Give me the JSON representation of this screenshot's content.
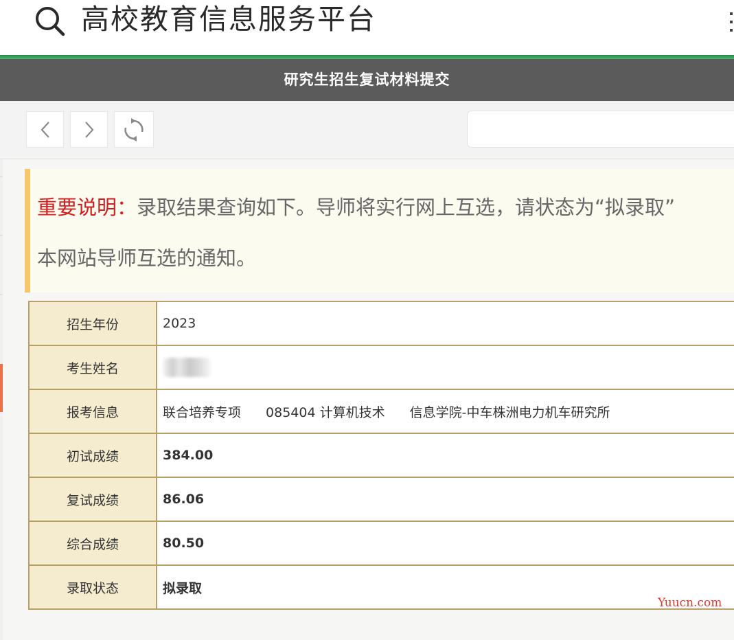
{
  "header": {
    "app_title": "高校教育信息服务平台",
    "search_icon": "search-icon",
    "accent_color": "#1d8a4a"
  },
  "title_bar": {
    "title": "研究生招生复试材料提交"
  },
  "toolbar": {
    "back_icon": "chevron-left-icon",
    "forward_icon": "chevron-right-icon",
    "refresh_icon": "refresh-icon",
    "url_value": ""
  },
  "notice": {
    "label": "重要说明：",
    "line1_text": "录取结果查询如下。导师将实行网上互选，请状态为“拟录取”",
    "line2_text": "本网站导师互选的通知。"
  },
  "info_table": {
    "rows": [
      {
        "label": "招生年份",
        "value": "2023"
      },
      {
        "label": "考生姓名",
        "value": ""
      },
      {
        "label": "报考信息",
        "value_parts": [
          "联合培养专项",
          "085404 计算机技术",
          "信息学院-中车株洲电力机车研究所"
        ]
      },
      {
        "label": "初试成绩",
        "value": "384.00"
      },
      {
        "label": "复试成绩",
        "value": "86.06"
      },
      {
        "label": "综合成绩",
        "value": "80.50"
      },
      {
        "label": "录取状态",
        "value": "拟录取"
      }
    ],
    "highlight_color": "#cc1111"
  },
  "watermark": "Yuucn.com"
}
